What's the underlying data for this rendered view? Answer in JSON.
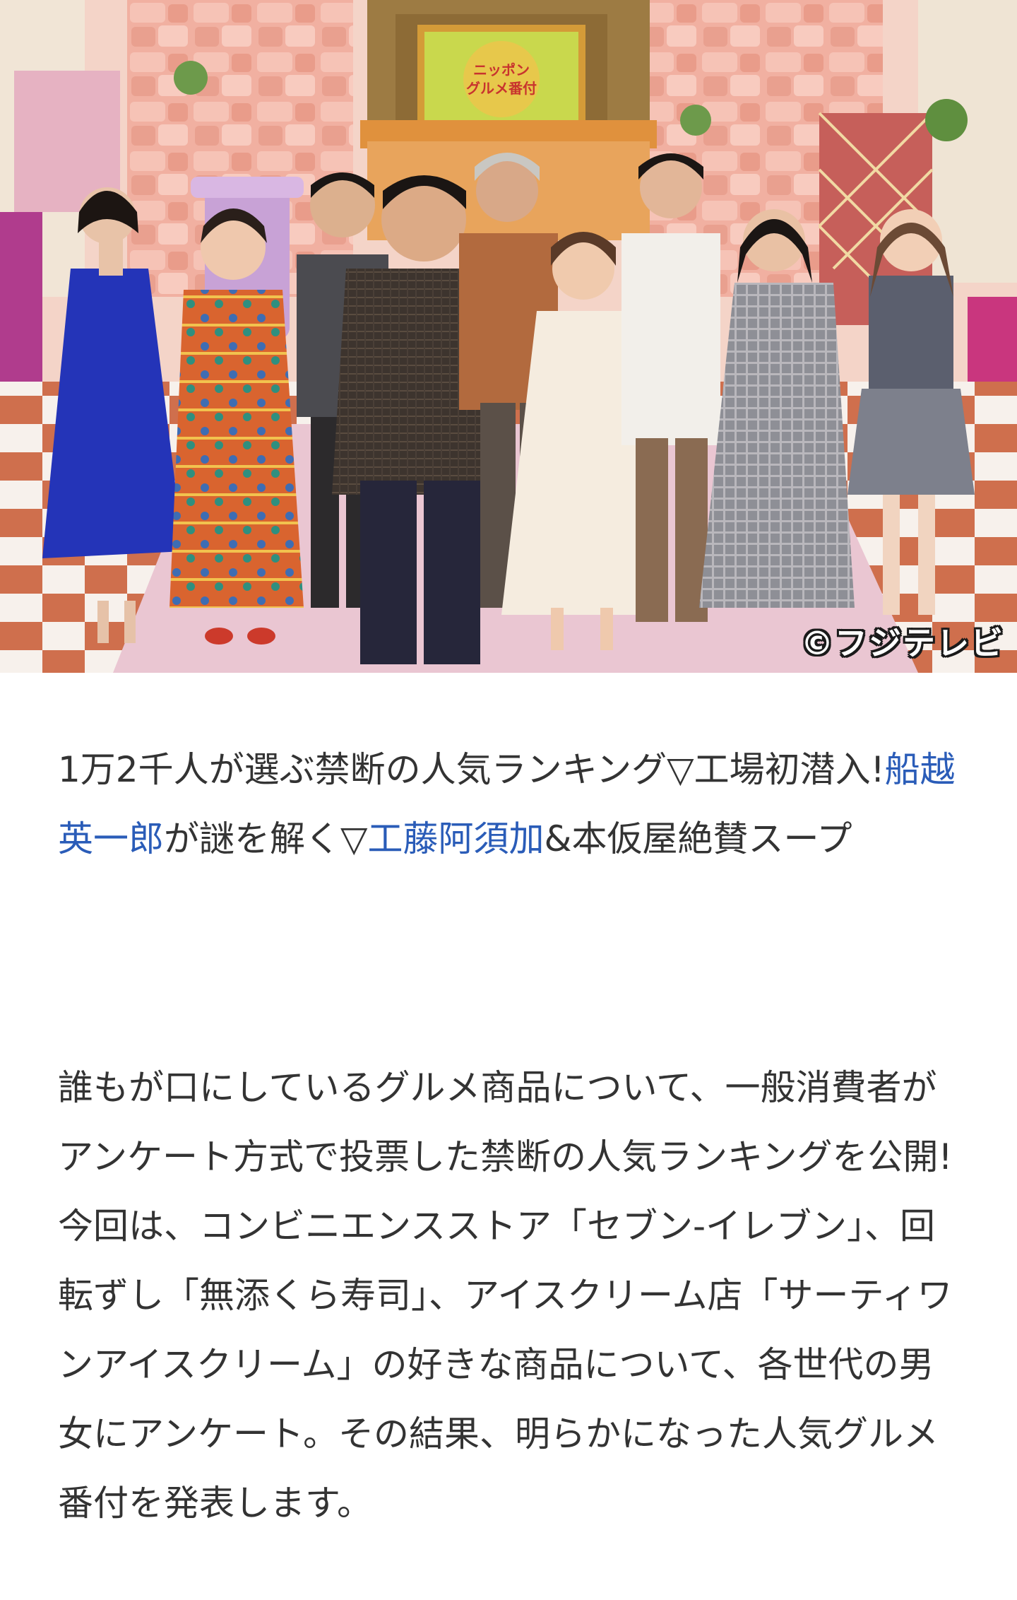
{
  "hero": {
    "image_label": "ニッポン グルメ番付",
    "credit": "©フジテレビ",
    "colors": {
      "wall": "#f0a99a",
      "floor_light": "#f7f3ef",
      "floor_dark": "#c96a4a",
      "carpet": "#e8c7d4"
    }
  },
  "headline": {
    "part1": "1万2千人が選ぶ禁断の人気ランキング▽工場初潜入!",
    "link1": "船越英一郎",
    "part2": "が謎を解く▽",
    "link2": "工藤阿須加",
    "part3": "&本仮屋絶賛スープ"
  },
  "body": {
    "paragraph": "誰もが口にしているグルメ商品について、一般消費者がアンケート方式で投票した禁断の人気ランキングを公開!今回は、コンビニエンスストア「セブン‐イレブン」、回転ずし「無添くら寿司」、アイスクリーム店「サーティワンアイスクリーム」の好きな商品について、各世代の男女にアンケート。その結果、明らかになった人気グルメ番付を発表します。"
  },
  "colors": {
    "link": "#2a5cb8",
    "text": "#333333"
  }
}
